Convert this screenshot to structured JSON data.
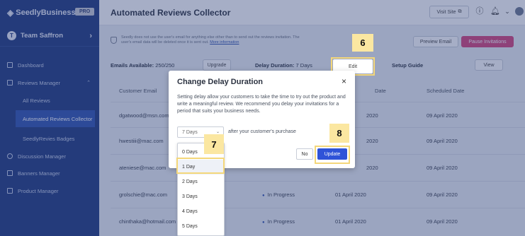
{
  "sidebar": {
    "brand": "SeedlyBusiness",
    "pro_label": "PRO",
    "team_name": "Team Saffron",
    "team_initial": "T",
    "items": [
      {
        "label": "Dashboard",
        "icon": "dashboard-icon"
      },
      {
        "label": "Reviews Manager",
        "icon": "reviews-icon"
      },
      {
        "label": "All Reviews"
      },
      {
        "label": "Automated Reviews Collector"
      },
      {
        "label": "SeedlyRevies Badges"
      },
      {
        "label": "Discussion Manager",
        "icon": "discussion-icon"
      },
      {
        "label": "Banners Manager",
        "icon": "banner-icon"
      },
      {
        "label": "Product Manager",
        "icon": "product-icon"
      }
    ]
  },
  "header": {
    "title": "Automated Reviews Collector",
    "visit_site": "Visit Site"
  },
  "notice": {
    "text": "Seedly does not use the user's email for anything else other than to send out the reviews invitation. The user's email data will be deleted once it is sent out.",
    "link": "More information"
  },
  "toolbar": {
    "preview": "Preview Email",
    "pause": "Pause Invitations"
  },
  "stats": {
    "emails_label": "Emails Available:",
    "emails_value": "250/250",
    "upgrade": "Upgrade",
    "delay_label": "Delay Duration:",
    "delay_value": "7 Days",
    "edit": "Edit",
    "setup_label": "Setup Guide",
    "view": "View"
  },
  "table": {
    "headers": {
      "email": "Customer Email",
      "date_partial": "Date",
      "scheduled": "Scheduled Date"
    },
    "rows": [
      {
        "email": "dgatwood@msn.com",
        "status": "",
        "date": "2020",
        "scheduled": "09 April 2020"
      },
      {
        "email": "hwestiii@mac.com",
        "status": "",
        "date": "2020",
        "scheduled": "09 April 2020"
      },
      {
        "email": "ateniese@mac.com",
        "status": "",
        "date": "2020",
        "scheduled": "09 April 2020"
      },
      {
        "email": "grolschie@mac.com",
        "status": "In Progress",
        "date": "01 April 2020",
        "scheduled": "09 April 2020"
      },
      {
        "email": "chinthaka@hotmail.com",
        "status": "In Progress",
        "date": "01 April 2020",
        "scheduled": "09 April 2020"
      }
    ]
  },
  "modal": {
    "title": "Change Delay Duration",
    "close": "×",
    "description": "Setting delay allow your customers to take the time to try out the product and write a meaningful review. We recommend you delay your invitations for a period that suits your business needs.",
    "select_value": "7 Days",
    "after_text": "after your customer's purchase",
    "no": "No",
    "update": "Update"
  },
  "dropdown": {
    "options": [
      "0 Days",
      "1 Day",
      "2 Days",
      "3 Days",
      "4 Days",
      "5 Days"
    ],
    "highlighted": "1 Day"
  },
  "callouts": {
    "edit_step": "6",
    "option_step": "7",
    "update_step": "8"
  },
  "colors": {
    "sidebar": "#1f3a7e",
    "accent": "#2f53d8",
    "pause": "#d6447a",
    "highlight": "#f4d77a"
  }
}
